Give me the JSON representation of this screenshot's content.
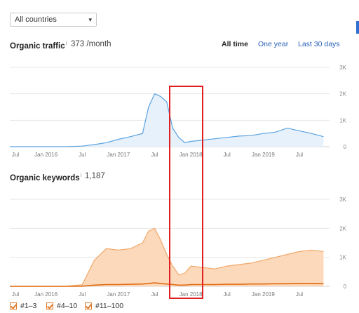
{
  "country_select": {
    "value": "All countries",
    "caret": "▾"
  },
  "traffic": {
    "title": "Organic traffic",
    "info": "i",
    "value": "373 /month",
    "tabs": [
      "All time",
      "One year",
      "Last 30 days"
    ],
    "active_tab": "All time"
  },
  "keywords": {
    "title": "Organic keywords",
    "info": "i",
    "value": "1,187"
  },
  "legend": {
    "items": [
      {
        "label": "#1–3",
        "checked": true
      },
      {
        "label": "#4–10",
        "checked": true
      },
      {
        "label": "#11–100",
        "checked": true
      }
    ]
  },
  "colors": {
    "accent_blue": "#2a62b8",
    "traffic_line": "#5ba3e0",
    "traffic_fill": "#e6f1fb",
    "keywords_line": "#f0a86a",
    "keywords_fill": "#fcd9bb",
    "low_rank_line": "#e06a10",
    "highlight_box": "#e02020",
    "grid": "#e6e6e6"
  },
  "chart_data": [
    {
      "type": "area",
      "name": "organic-traffic",
      "x_tick_labels": [
        "Jul",
        "Jan 2016",
        "Jul",
        "Jan 2017",
        "Jul",
        "Jan 2018",
        "Jul",
        "Jan 2019",
        "Jul"
      ],
      "y_tick_labels": [
        "3K",
        "2K",
        "1K",
        "0"
      ],
      "ylim": [
        0,
        3000
      ],
      "xlim": [
        "2015-07",
        "2019-12"
      ],
      "grid": true,
      "series": [
        {
          "x": [
            "2015-07",
            "2016-01",
            "2016-04",
            "2016-07",
            "2016-09",
            "2016-11",
            "2017-01",
            "2017-03",
            "2017-05",
            "2017-06",
            "2017-07",
            "2017-08",
            "2017-09",
            "2017-10",
            "2017-11",
            "2017-12",
            "2018-01",
            "2018-03",
            "2018-05",
            "2018-07",
            "2018-09",
            "2018-11",
            "2019-01",
            "2019-03",
            "2019-05",
            "2019-07",
            "2019-09",
            "2019-11"
          ],
          "values": [
            0,
            0,
            0,
            20,
            80,
            150,
            280,
            380,
            500,
            1500,
            2000,
            1900,
            1700,
            700,
            350,
            150,
            200,
            250,
            300,
            350,
            400,
            420,
            500,
            550,
            700,
            600,
            500,
            380
          ]
        }
      ]
    },
    {
      "type": "area",
      "name": "organic-keywords",
      "x_tick_labels": [
        "Jul",
        "Jan 2016",
        "Jul",
        "Jan 2017",
        "Jul",
        "Jan 2018",
        "Jul",
        "Jan 2019",
        "Jul"
      ],
      "y_tick_labels": [
        "3K",
        "2K",
        "1K",
        "0"
      ],
      "ylim": [
        0,
        3000
      ],
      "xlim": [
        "2015-07",
        "2019-12"
      ],
      "grid": true,
      "series": [
        {
          "values_total": [
            0,
            0,
            0,
            50,
            900,
            1300,
            1250,
            1300,
            1500,
            1900,
            2000,
            1600,
            1100,
            700,
            400,
            450,
            700,
            650,
            600,
            700,
            750,
            800,
            900,
            1000,
            1100,
            1200,
            1250,
            1200
          ],
          "values_top10": [
            0,
            0,
            0,
            5,
            40,
            60,
            60,
            70,
            80,
            100,
            120,
            100,
            80,
            60,
            40,
            40,
            60,
            60,
            60,
            70,
            70,
            80,
            80,
            90,
            90,
            100,
            100,
            90
          ],
          "x": [
            "2015-07",
            "2016-01",
            "2016-04",
            "2016-07",
            "2016-09",
            "2016-11",
            "2017-01",
            "2017-03",
            "2017-05",
            "2017-06",
            "2017-07",
            "2017-08",
            "2017-09",
            "2017-10",
            "2017-11",
            "2017-12",
            "2018-01",
            "2018-03",
            "2018-05",
            "2018-07",
            "2018-09",
            "2018-11",
            "2019-01",
            "2019-03",
            "2019-05",
            "2019-07",
            "2019-09",
            "2019-11"
          ]
        }
      ]
    }
  ]
}
